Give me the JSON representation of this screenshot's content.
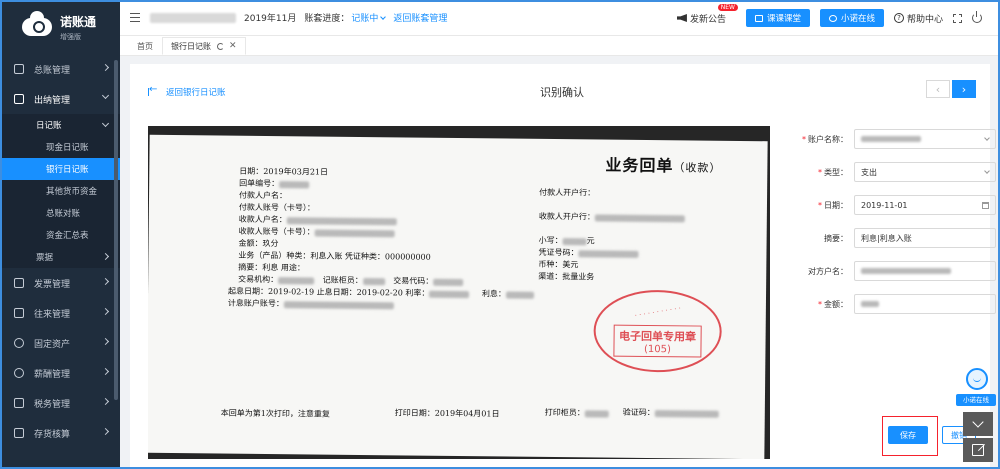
{
  "app": {
    "name": "诺账通",
    "edition": "增强版"
  },
  "topbar": {
    "period": "2019年11月",
    "status_label": "账套进度：",
    "status_value": "记账中",
    "back_manage": "返回账套管理",
    "announce": "发新公告",
    "new_badge": "NEW",
    "course_btn": "课课课堂",
    "online_btn": "小诺在线",
    "help": "帮助中心"
  },
  "sidebar": {
    "items": [
      {
        "label": "总账管理"
      },
      {
        "label": "出纳管理"
      },
      {
        "label": "发票管理"
      },
      {
        "label": "往来管理"
      },
      {
        "label": "固定资产"
      },
      {
        "label": "薪酬管理"
      },
      {
        "label": "税务管理"
      },
      {
        "label": "存货核算"
      }
    ],
    "sub": {
      "head": "日记账",
      "leaves": [
        "现金日记账",
        "银行日记账",
        "其他货币资金",
        "总账对账",
        "资金汇总表"
      ],
      "next": "票据"
    }
  },
  "tabs": [
    {
      "label": "首页"
    },
    {
      "label": "银行日记账"
    }
  ],
  "page": {
    "back_link": "返回银行日记账",
    "title": "识别确认"
  },
  "receipt": {
    "title": "业务回单",
    "title_suffix": "（收款）",
    "date": "日期：2019年03月21日",
    "receipt_no": "回单编号：",
    "payer_name": "付款人户名：",
    "payer_acct": "付款人账号（卡号）：",
    "payee_name": "收款人户名：",
    "payee_acct": "收款人账号（卡号）：",
    "amount": "金额：玖分",
    "biz": "业务（产品）种类：利息入账   凭证种类：000000000",
    "summary": "摘要：利息   用途：",
    "org": "交易机构：",
    "teller": "记账柜员：",
    "code": "交易代码：",
    "period": "起息日期：2019-02-19 止息日期：2019-02-20 利率：",
    "interest": "利息：",
    "interest_acct": "计息账户账号：",
    "payer_bank": "付款人开户行：",
    "payee_bank": "收款人开户行：",
    "lower": "小写：",
    "lower_suffix": "元",
    "voucher_no": "凭证号码：",
    "currency": "币种：美元",
    "channel": "渠道：批量业务",
    "footer_note": "本回单为第1次打印，注意重复",
    "print_date": "打印日期：2019年04月01日",
    "print_teller": "打印柜员：",
    "verify": "验证码：",
    "stamp_text": "电子回单专用章",
    "stamp_num": "(105)"
  },
  "form": {
    "account_label": "账户名称：",
    "type_label": "类型：",
    "type_value": "支出",
    "date_label": "日期：",
    "date_value": "2019-11-01",
    "summary_label": "摘要：",
    "summary_value": "利息|利息入账",
    "counterparty_label": "对方户名：",
    "amount_label": "金额："
  },
  "actions": {
    "save": "保存",
    "cancel": "撤销"
  },
  "assistant": {
    "label": "小诺在线"
  }
}
